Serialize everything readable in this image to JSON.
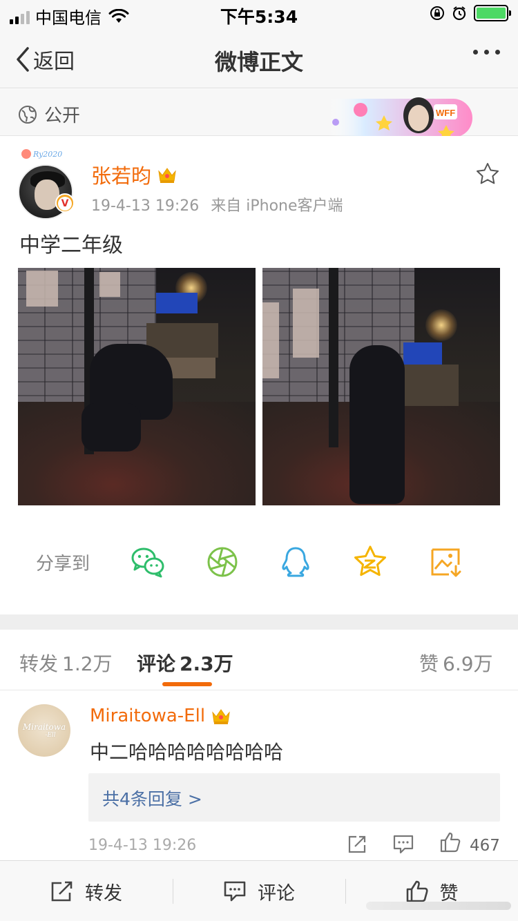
{
  "status_bar": {
    "carrier": "中国电信",
    "time": "下午5:34",
    "icons": [
      "signal-icon",
      "wifi-icon",
      "orientation-lock-icon",
      "alarm-icon",
      "battery-charging-icon"
    ]
  },
  "nav": {
    "back_label": "返回",
    "title": "微博正文",
    "more_icon": "more-dots-icon"
  },
  "visibility": {
    "label": "公开",
    "icon": "globe-icon",
    "banner_text": "WFF"
  },
  "post": {
    "author": "张若昀",
    "timestamp": "19-4-13 19:26",
    "source": "来自 iPhone客户端",
    "text": "中学二年级",
    "avatar_tag": "Ry2020",
    "verified_badge": "V",
    "photos": [
      {
        "name": "photo-1"
      },
      {
        "name": "photo-2"
      }
    ]
  },
  "share": {
    "label": "分享到",
    "targets": [
      {
        "name": "wechat",
        "icon": "wechat-icon",
        "color": "#2ebd6b"
      },
      {
        "name": "moments",
        "icon": "moments-icon",
        "color": "#7cc24a"
      },
      {
        "name": "qq",
        "icon": "qq-icon",
        "color": "#39a7e0"
      },
      {
        "name": "qzone",
        "icon": "qzone-icon",
        "color": "#f5b400"
      },
      {
        "name": "save-image",
        "icon": "save-image-icon",
        "color": "#f5a623"
      }
    ]
  },
  "tabs": [
    {
      "label": "转发",
      "count": "1.2万",
      "active": false
    },
    {
      "label": "评论",
      "count": "2.3万",
      "active": true
    },
    {
      "label": "赞",
      "count": "6.9万",
      "active": false
    }
  ],
  "comment": {
    "user": "Miraitowa-Ell",
    "avatar_text": "Miraitowa",
    "avatar_sub": "-Ell",
    "text": "中二哈哈哈哈哈哈哈哈",
    "replies_label": "共4条回复 >",
    "timestamp": "19-4-13 19:26",
    "likes": "467"
  },
  "bottom_bar": {
    "repost_label": "转发",
    "comment_label": "评论",
    "like_label": "赞"
  },
  "colors": {
    "accent": "#f26b0b",
    "link": "#4a6fa5",
    "badge_gold": "#f5a623"
  }
}
